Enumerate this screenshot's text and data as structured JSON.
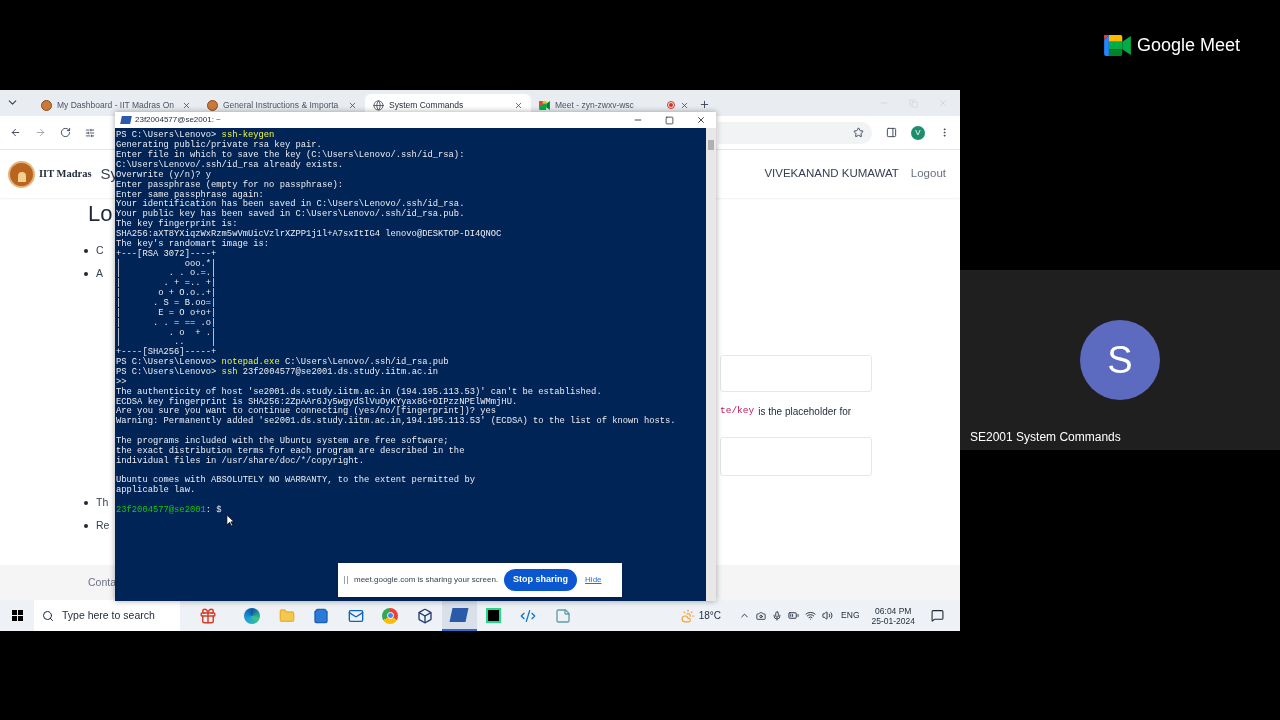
{
  "meet": {
    "logo_text": "Google Meet",
    "participant": {
      "initial": "S",
      "name": "SE2001 System Commands"
    }
  },
  "browser": {
    "tabs": [
      {
        "title": "My Dashboard - IIT Madras On",
        "kind": "logo",
        "recording": false,
        "selected": false
      },
      {
        "title": "General Instructions & Importa",
        "kind": "logo",
        "recording": false,
        "selected": false
      },
      {
        "title": "System Commands",
        "kind": "globe",
        "recording": false,
        "selected": true
      },
      {
        "title": "Meet - zyn-zwxv-wsc",
        "kind": "meet",
        "recording": true,
        "selected": false
      }
    ],
    "profile_initial": "V"
  },
  "page": {
    "brand": "IIT Madras",
    "title": "Sy",
    "user": "VIVEKANAND KUMAWAT",
    "logout": "Logout",
    "heading": "Lo",
    "bullets_top": [
      "C",
      "A"
    ],
    "bullets_bottom": [
      "Th",
      "Re"
    ],
    "code_fragment": "te/key",
    "text_fragment": "is the placeholder for",
    "footer": "Conta"
  },
  "terminal": {
    "title": "23f2004577@se2001: ~",
    "lines": [
      {
        "kind": "command",
        "prompt": "PS C:\\Users\\Lenovo>",
        "command": "ssh-keygen"
      },
      {
        "kind": "output",
        "text": "Generating public/private rsa key pair."
      },
      {
        "kind": "output",
        "text": "Enter file in which to save the key (C:\\Users\\Lenovo/.ssh/id_rsa):"
      },
      {
        "kind": "output",
        "text": "C:\\Users\\Lenovo/.ssh/id_rsa already exists."
      },
      {
        "kind": "output",
        "text": "Overwrite (y/n)? y"
      },
      {
        "kind": "output",
        "text": "Enter passphrase (empty for no passphrase):"
      },
      {
        "kind": "output",
        "text": "Enter same passphrase again:"
      },
      {
        "kind": "output",
        "text": "Your identification has been saved in C:\\Users\\Lenovo/.ssh/id_rsa."
      },
      {
        "kind": "output",
        "text": "Your public key has been saved in C:\\Users\\Lenovo/.ssh/id_rsa.pub."
      },
      {
        "kind": "output",
        "text": "The key fingerprint is:"
      },
      {
        "kind": "output",
        "text": "SHA256:aXT8YXiqzWxRzm5wVmUicVzlrXZPP1j1l+A7sxItIG4 lenovo@DESKTOP-DI4QNOC"
      },
      {
        "kind": "output",
        "text": "The key's randomart image is:"
      },
      {
        "kind": "output",
        "text": "+---[RSA 3072]----+"
      },
      {
        "kind": "output",
        "text": "|            ooo.*|"
      },
      {
        "kind": "output",
        "text": "|         . . o.=.|"
      },
      {
        "kind": "output",
        "text": "|        . + =.. +|"
      },
      {
        "kind": "output",
        "text": "|       o + O.o..+|"
      },
      {
        "kind": "output",
        "text": "|      . S = B.oo=|"
      },
      {
        "kind": "output",
        "text": "|       E = O o+o+|"
      },
      {
        "kind": "output",
        "text": "|      . . = == .o|"
      },
      {
        "kind": "output",
        "text": "|         . o  + .|"
      },
      {
        "kind": "output",
        "text": "|          ..     |"
      },
      {
        "kind": "output",
        "text": "+----[SHA256]-----+"
      },
      {
        "kind": "command",
        "prompt": "PS C:\\Users\\Lenovo>",
        "command": "notepad.exe",
        "args": "C:\\Users\\Lenovo/.ssh/id_rsa.pub"
      },
      {
        "kind": "command",
        "prompt": "PS C:\\Users\\Lenovo>",
        "command": "ssh",
        "args": "23f2004577@se2001.ds.study.iitm.ac.in"
      },
      {
        "kind": "output",
        "text": ">>"
      },
      {
        "kind": "output",
        "text": "The authenticity of host 'se2001.ds.study.iitm.ac.in (194.195.113.53)' can't be established."
      },
      {
        "kind": "output",
        "text": "ECDSA key fingerprint is SHA256:2ZpAAr6Jy5wgydSlVuOyKYyax8G+OIPzzNPElWMmjHU."
      },
      {
        "kind": "output",
        "text": "Are you sure you want to continue connecting (yes/no/[fingerprint])? yes"
      },
      {
        "kind": "output",
        "text": "Warning: Permanently added 'se2001.ds.study.iitm.ac.in,194.195.113.53' (ECDSA) to the list of known hosts."
      },
      {
        "kind": "blank"
      },
      {
        "kind": "output",
        "text": "The programs included with the Ubuntu system are free software;"
      },
      {
        "kind": "output",
        "text": "the exact distribution terms for each program are described in the"
      },
      {
        "kind": "output",
        "text": "individual files in /usr/share/doc/*/copyright."
      },
      {
        "kind": "blank"
      },
      {
        "kind": "output",
        "text": "Ubuntu comes with ABSOLUTELY NO WARRANTY, to the extent permitted by"
      },
      {
        "kind": "output",
        "text": "applicable law."
      },
      {
        "kind": "blank"
      },
      {
        "kind": "shell",
        "user": "23f2004577@se2001",
        "rest": ": $"
      }
    ]
  },
  "share_bar": {
    "message": "meet.google.com is sharing your screen.",
    "stop": "Stop sharing",
    "hide": "Hide"
  },
  "taskbar": {
    "search_placeholder": "Type here to search",
    "apps": [
      {
        "kind": "edge",
        "active": false
      },
      {
        "kind": "explorer",
        "active": false
      },
      {
        "kind": "store",
        "active": false
      },
      {
        "kind": "mail",
        "active": false
      },
      {
        "kind": "chrome",
        "active": false
      },
      {
        "kind": "virtualbox",
        "active": false
      },
      {
        "kind": "powershell",
        "active": true
      },
      {
        "kind": "pycharm",
        "active": false
      },
      {
        "kind": "vscode",
        "active": false
      },
      {
        "kind": "notes",
        "active": false
      }
    ],
    "temperature": "18°C",
    "language": "ENG",
    "time": "06:04 PM",
    "date": "25-01-2024"
  }
}
